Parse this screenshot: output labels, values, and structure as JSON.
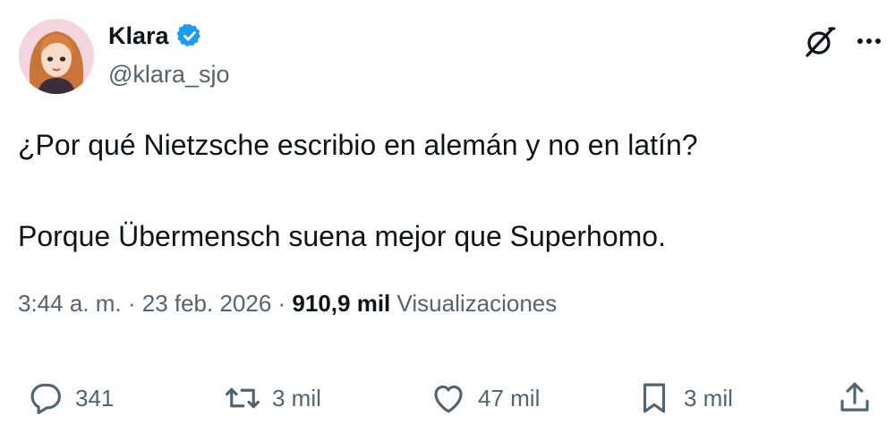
{
  "author": {
    "name": "Klara",
    "handle": "@klara_sjo"
  },
  "tweet": {
    "line1": "¿Por qué Nietzsche escribio en alemán y no en latín?",
    "line2": "Porque Übermensch suena mejor que Superhomo."
  },
  "meta": {
    "time": "3:44 a. m.",
    "separator1": " · ",
    "date": "23 feb. 2026",
    "separator2": " · ",
    "views_count": "910,9 mil",
    "views_label": " Visualizaciones"
  },
  "actions": {
    "replies": "341",
    "reposts": "3 mil",
    "likes": "47 mil",
    "bookmarks": "3 mil"
  },
  "icons": {
    "verified": "verified-badge-icon",
    "grok": "grok-icon",
    "more": "more-options-icon",
    "reply": "reply-icon",
    "repost": "repost-icon",
    "like": "heart-icon",
    "bookmark": "bookmark-icon",
    "share": "share-icon"
  },
  "colors": {
    "verified_blue": "#1d9bf0",
    "text_primary": "#0f1419",
    "text_secondary": "#536471"
  }
}
